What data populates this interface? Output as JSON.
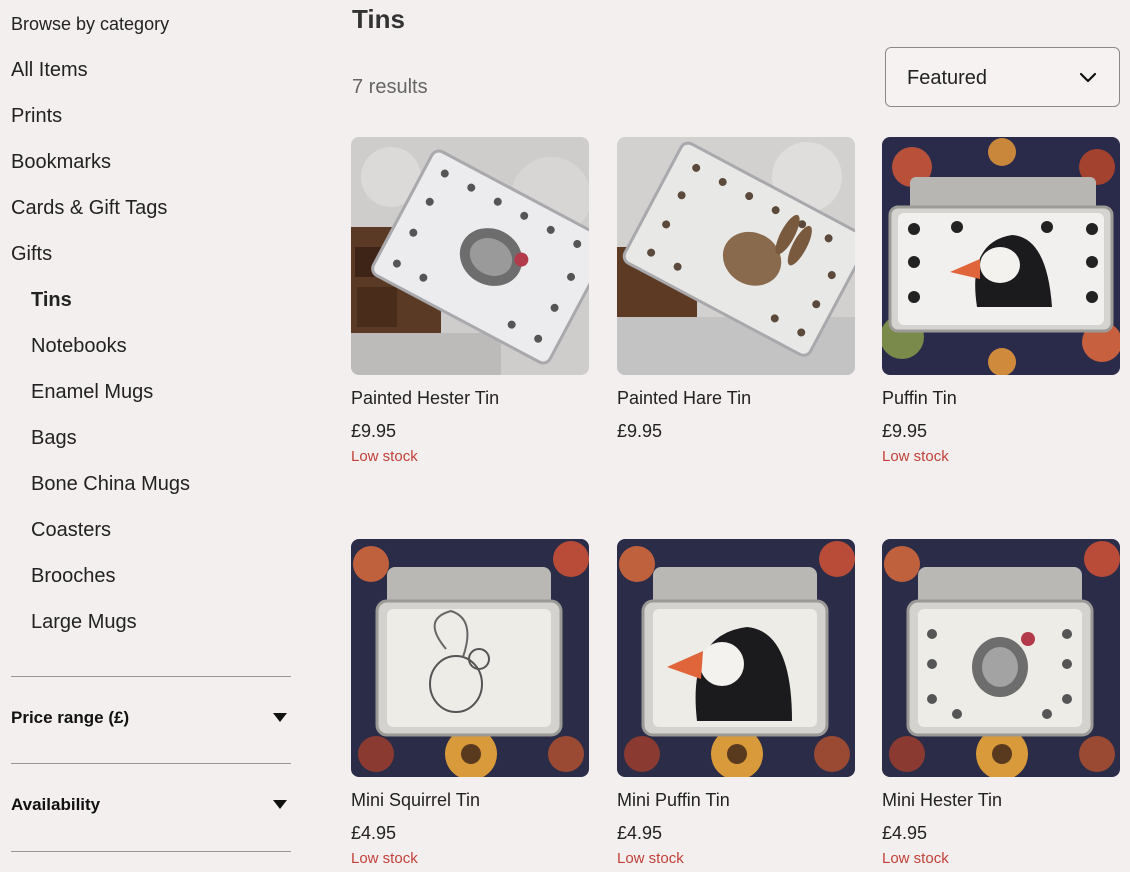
{
  "sidebar": {
    "heading": "Browse by category",
    "categories": [
      {
        "label": "All Items"
      },
      {
        "label": "Prints"
      },
      {
        "label": "Bookmarks"
      },
      {
        "label": "Cards & Gift Tags"
      },
      {
        "label": "Gifts"
      }
    ],
    "subcategories": [
      {
        "label": "Tins",
        "active": true
      },
      {
        "label": "Notebooks"
      },
      {
        "label": "Enamel Mugs"
      },
      {
        "label": "Bags"
      },
      {
        "label": "Bone China Mugs"
      },
      {
        "label": "Coasters"
      },
      {
        "label": "Brooches"
      },
      {
        "label": "Large Mugs"
      }
    ],
    "filters": [
      {
        "label": "Price range (£)"
      },
      {
        "label": "Availability"
      }
    ]
  },
  "main": {
    "title": "Tins",
    "results": "7 results",
    "sort": {
      "value": "Featured"
    },
    "products": [
      {
        "name": "Painted Hester Tin",
        "price": "£9.95",
        "stock": "Low stock"
      },
      {
        "name": "Painted Hare Tin",
        "price": "£9.95",
        "stock": ""
      },
      {
        "name": "Puffin Tin",
        "price": "£9.95",
        "stock": "Low stock"
      },
      {
        "name": "Mini Squirrel Tin",
        "price": "£4.95",
        "stock": "Low stock"
      },
      {
        "name": "Mini Puffin Tin",
        "price": "£4.95",
        "stock": "Low stock"
      },
      {
        "name": "Mini Hester Tin",
        "price": "£4.95",
        "stock": "Low stock"
      }
    ]
  },
  "colors": {
    "background": "#f3efee",
    "low_stock": "#c2413a",
    "text": "#222222"
  }
}
